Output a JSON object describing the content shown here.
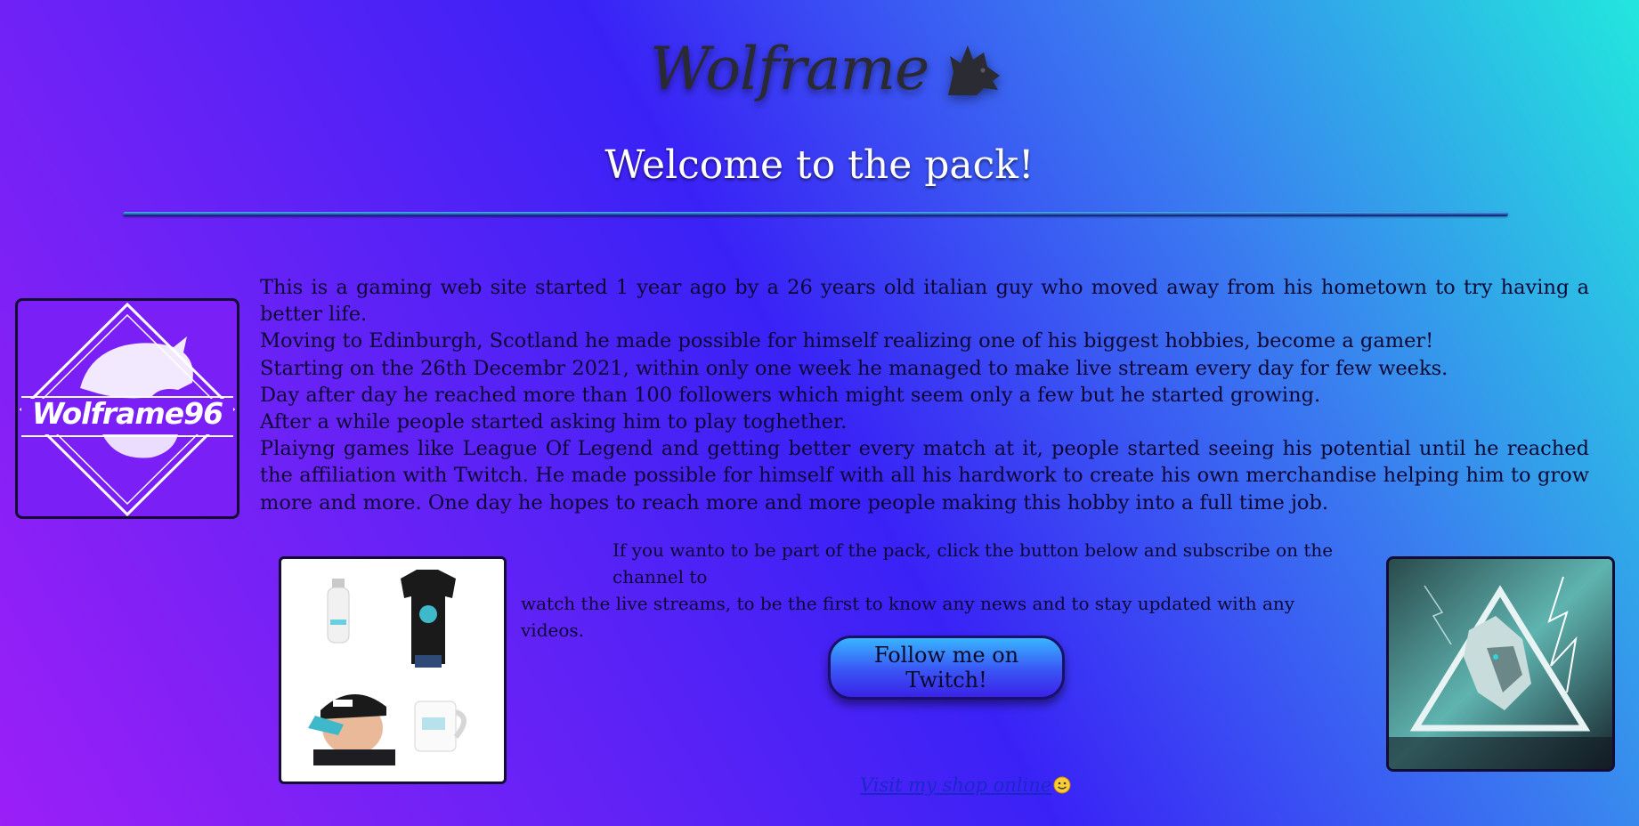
{
  "header": {
    "brand_name": "Wolframe",
    "welcome": "Welcome to the pack!"
  },
  "logo": {
    "text": "Wolframe96"
  },
  "about": {
    "lines": [
      "This is a gaming web site started 1 year ago by a 26 years old italian guy who moved away from his hometown to try having a better life.",
      "Moving to Edinburgh, Scotland he made possible for himself realizing one of his biggest hobbies, become a gamer!",
      "Starting on the 26th Decembr 2021, within only one week he managed to make live stream every day for few weeks.",
      "Day after day he reached more than 100 followers which might seem only a few but he started growing.",
      "After a while people started asking him to play toghether.",
      "Plaiyng games like League Of Legend and getting better every match at it, people started seeing his potential until he reached the affiliation with Twitch. He made possible for himself with all his hardwork to create his own merchandise helping him to grow more and more. One day he hopes to reach more and more people making this hobby into a full time job."
    ]
  },
  "cta": {
    "line1": "If you wanto to be part of the pack, click the button below and subscribe on the channel to",
    "line2": "watch the live streams, to be the first to know any news and to stay updated with any videos.",
    "button_label": "Follow me on Twitch!",
    "shop_link": "Visit my shop online"
  },
  "colors": {
    "background_start": "#9b1ff7",
    "background_mid": "#3a22f6",
    "background_end": "#22e7dd",
    "button_top": "#38b4ff",
    "button_bottom": "#3a22e8"
  }
}
